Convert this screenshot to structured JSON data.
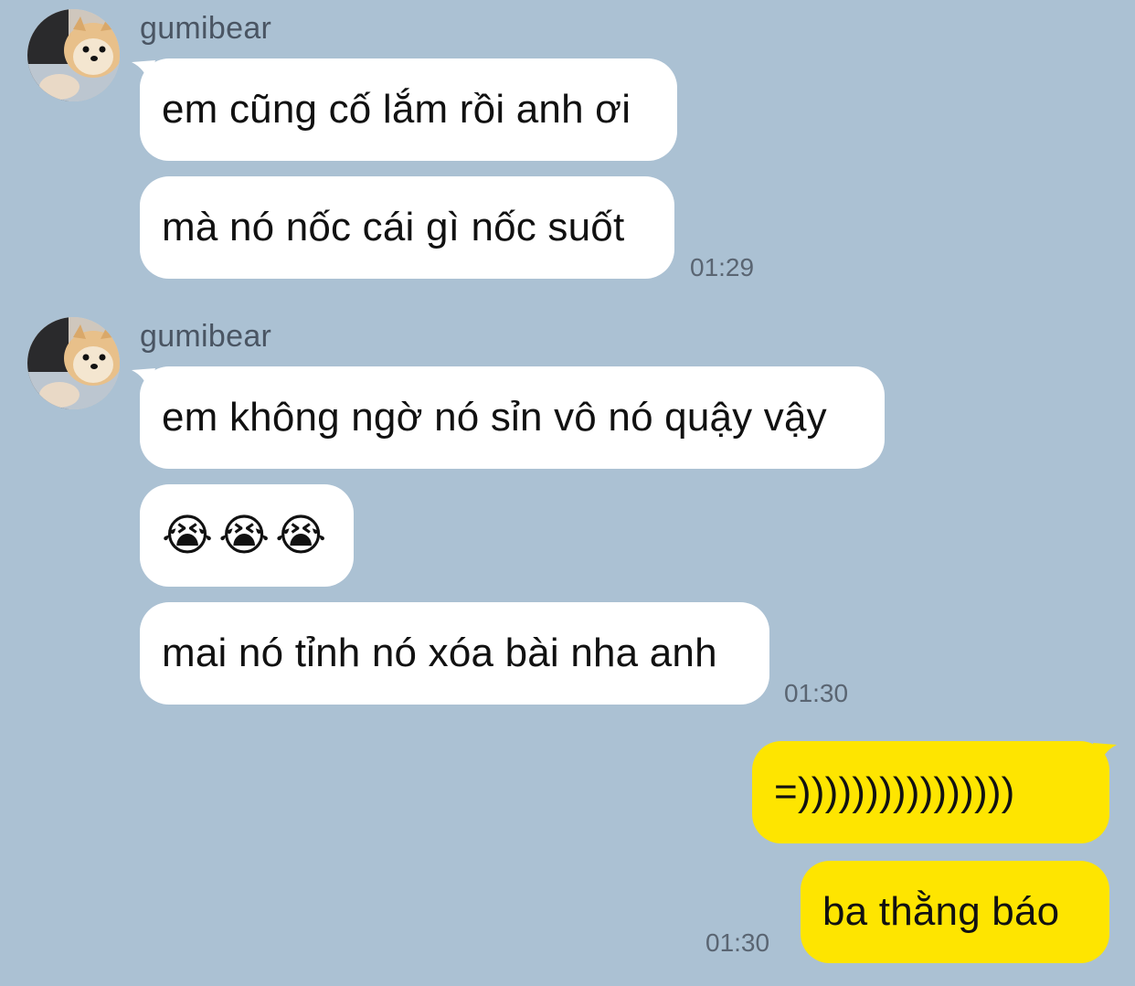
{
  "colors": {
    "background": "#abc1d3",
    "incoming_bubble": "#ffffff",
    "outgoing_bubble": "#fee500"
  },
  "groups": [
    {
      "sender": "gumibear",
      "avatar": "pomeranian-dog-avatar",
      "messages": [
        "em cũng cố lắm rồi anh ơi",
        "mà nó nốc cái gì nốc suốt"
      ],
      "time": "01:29"
    },
    {
      "sender": "gumibear",
      "avatar": "pomeranian-dog-avatar",
      "messages": [
        "em không ngờ nó sỉn vô nó quậy vậy",
        "😭😭😭",
        "mai nó tỉnh nó xóa bài nha anh"
      ],
      "time": "01:30"
    }
  ],
  "outgoing": {
    "messages": [
      "=))))))))))))))))",
      "ba thằng báo"
    ],
    "time": "01:30"
  }
}
